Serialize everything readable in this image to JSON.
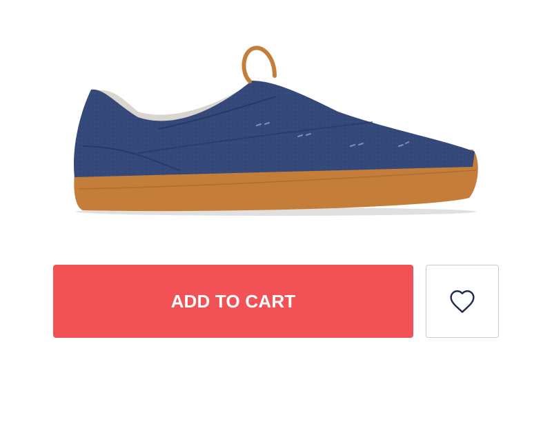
{
  "product": {
    "image_icon": "slip-on-shoe-image",
    "upper_color": "#34497a",
    "sole_color": "#c47e3a",
    "lining_color": "#d9d6cf"
  },
  "actions": {
    "add_to_cart_label": "ADD TO CART",
    "add_to_cart_color": "#f25255",
    "wishlist_icon": "heart-outline-icon",
    "wishlist_icon_color": "#1e2a4a"
  }
}
